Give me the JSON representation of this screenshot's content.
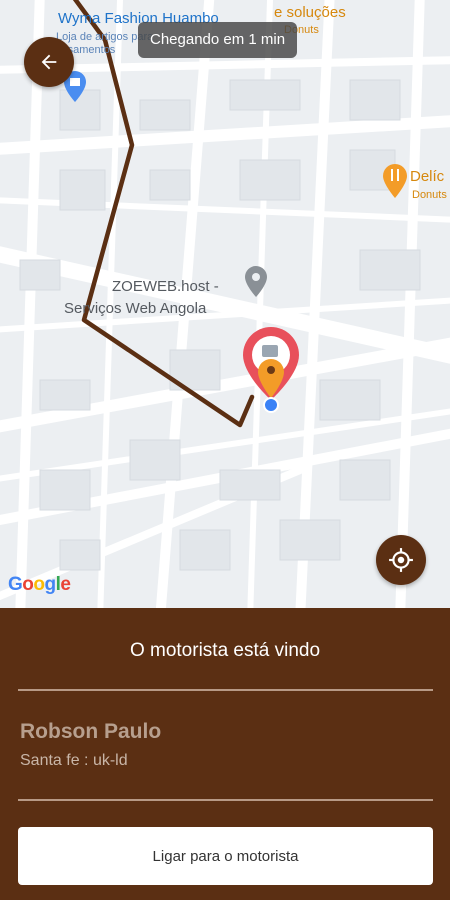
{
  "map": {
    "arrival_chip": "Chegando em 1 min",
    "pois": [
      {
        "name": "Wyma Fashion Huambo",
        "description": "Loja de artigos para casamentos"
      },
      {
        "name": "e soluções",
        "description": "Donuts"
      },
      {
        "name": "Delíc",
        "description": "Donuts"
      },
      {
        "name": "ZOEWEB.host -",
        "description": "Serviços Web Angola"
      }
    ],
    "google_logo": [
      "G",
      "o",
      "o",
      "g",
      "l",
      "e"
    ],
    "google_colors": [
      "#4285F4",
      "#EA4335",
      "#FBBC05",
      "#4285F4",
      "#34A853",
      "#EA4335"
    ]
  },
  "panel": {
    "status_title": "O motorista está vindo",
    "driver_name": "Robson Paulo",
    "vehicle_info": "Santa fe : uk-ld",
    "call_button_label": "Ligar para o motorista"
  },
  "colors": {
    "brand_brown": "#5b2f13",
    "route": "#5b2f13",
    "pin_red": "#e8505b",
    "pin_orange": "#f39c28",
    "user_dot": "#3b82f6"
  },
  "icons": {
    "back": "arrow-left-icon",
    "locate": "my-location-icon",
    "destination": "map-pin-icon",
    "poi_food": "fork-knife-icon",
    "poi_place": "place-pin-icon",
    "poi_shop": "shopping-bag-icon"
  }
}
